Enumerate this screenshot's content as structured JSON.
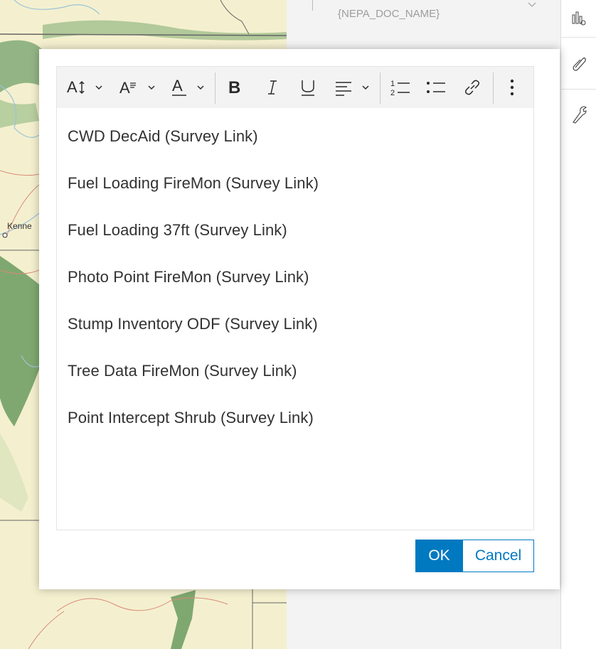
{
  "map": {
    "place_label": "Kenne"
  },
  "side_panel": {
    "field_value": "{NEPA_DOC_NAME}",
    "rail_icons": [
      "chart-settings-icon",
      "paperclip-icon",
      "wrench-icon"
    ]
  },
  "dialog": {
    "toolbar": {
      "font_size_icon": "font-size-icon",
      "font_family_icon": "font-family-icon",
      "font_color_icon": "font-color-icon",
      "bold_icon": "bold-icon",
      "italic_icon": "italic-icon",
      "underline_icon": "underline-icon",
      "align_icon": "align-icon",
      "numbered_list_icon": "numbered-list-icon",
      "bulleted_list_icon": "bulleted-list-icon",
      "link_icon": "link-icon",
      "more_icon": "more-icon"
    },
    "lines": [
      "CWD DecAid (Survey Link)",
      "Fuel Loading FireMon (Survey Link)",
      "Fuel Loading 37ft (Survey Link)",
      "Photo Point FireMon (Survey Link)",
      "Stump Inventory ODF (Survey Link)",
      "Tree Data FireMon (Survey Link)",
      "Point Intercept Shrub (Survey Link)"
    ],
    "ok_label": "OK",
    "cancel_label": "Cancel"
  },
  "colors": {
    "accent": "#0079c1",
    "map_base": "#f4f0cf",
    "forest": "#7fa870"
  }
}
